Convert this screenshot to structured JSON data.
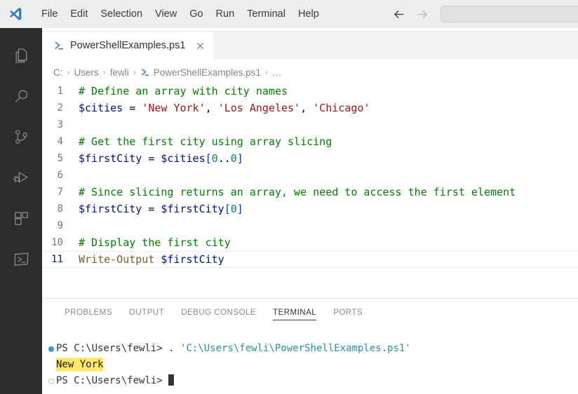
{
  "titlebar": {
    "logo_icon": "vscode-logo-icon",
    "menus": [
      {
        "label": "File"
      },
      {
        "label": "Edit"
      },
      {
        "label": "Selection"
      },
      {
        "label": "View"
      },
      {
        "label": "Go"
      },
      {
        "label": "Run"
      },
      {
        "label": "Terminal"
      },
      {
        "label": "Help"
      }
    ],
    "nav_back_icon": "arrow-left-icon",
    "nav_forward_icon": "arrow-right-icon",
    "command_center": {
      "value": "",
      "placeholder": ""
    }
  },
  "activitybar": {
    "items": [
      {
        "name": "explorer",
        "icon": "files-icon"
      },
      {
        "name": "search",
        "icon": "search-icon"
      },
      {
        "name": "source-control",
        "icon": "source-control-icon"
      },
      {
        "name": "run-and-debug",
        "icon": "run-debug-icon"
      },
      {
        "name": "extensions",
        "icon": "extensions-icon"
      },
      {
        "name": "terminal",
        "icon": "terminal-icon"
      }
    ]
  },
  "editor": {
    "tab": {
      "icon": "powershell-icon",
      "label": "PowerShellExamples.ps1",
      "close_icon": "close-icon",
      "dirty": false
    },
    "breadcrumb": {
      "separator": "›",
      "items": [
        {
          "label": "C:",
          "icon": ""
        },
        {
          "label": "Users",
          "icon": ""
        },
        {
          "label": "fewli",
          "icon": ""
        },
        {
          "label": "PowerShellExamples.ps1",
          "icon": "powershell-icon"
        },
        {
          "label": "…",
          "icon": ""
        }
      ]
    },
    "active_line": 11,
    "lines": [
      {
        "number": "1",
        "tokens": [
          {
            "t": "# Define an array with city names",
            "c": "tok-comment"
          }
        ]
      },
      {
        "number": "2",
        "tokens": [
          {
            "t": "$cities",
            "c": "tok-var"
          },
          {
            "t": " = ",
            "c": "tok-op"
          },
          {
            "t": "'New York'",
            "c": "tok-str"
          },
          {
            "t": ", ",
            "c": "tok-plain"
          },
          {
            "t": "'Los Angeles'",
            "c": "tok-str"
          },
          {
            "t": ", ",
            "c": "tok-plain"
          },
          {
            "t": "'Chicago'",
            "c": "tok-str"
          }
        ]
      },
      {
        "number": "3",
        "tokens": []
      },
      {
        "number": "4",
        "tokens": [
          {
            "t": "# Get the first city using array slicing",
            "c": "tok-comment"
          }
        ]
      },
      {
        "number": "5",
        "tokens": [
          {
            "t": "$firstCity",
            "c": "tok-var"
          },
          {
            "t": " = ",
            "c": "tok-op"
          },
          {
            "t": "$cities",
            "c": "tok-var"
          },
          {
            "t": "[",
            "c": "tok-bracket"
          },
          {
            "t": "0",
            "c": "tok-num"
          },
          {
            "t": "..",
            "c": "tok-plain"
          },
          {
            "t": "0",
            "c": "tok-num"
          },
          {
            "t": "]",
            "c": "tok-bracket"
          }
        ]
      },
      {
        "number": "6",
        "tokens": []
      },
      {
        "number": "7",
        "tokens": [
          {
            "t": "# Since slicing returns an array, we need to access the first element",
            "c": "tok-comment"
          }
        ]
      },
      {
        "number": "8",
        "tokens": [
          {
            "t": "$firstCity",
            "c": "tok-var"
          },
          {
            "t": " = ",
            "c": "tok-op"
          },
          {
            "t": "$firstCity",
            "c": "tok-var"
          },
          {
            "t": "[",
            "c": "tok-bracket"
          },
          {
            "t": "0",
            "c": "tok-num"
          },
          {
            "t": "]",
            "c": "tok-bracket"
          }
        ]
      },
      {
        "number": "9",
        "tokens": []
      },
      {
        "number": "10",
        "tokens": [
          {
            "t": "# Display the first city",
            "c": "tok-comment"
          }
        ]
      },
      {
        "number": "11",
        "tokens": [
          {
            "t": "Write-Output",
            "c": "tok-func"
          },
          {
            "t": " ",
            "c": "tok-plain"
          },
          {
            "t": "$firstCity",
            "c": "tok-var"
          }
        ]
      }
    ]
  },
  "panel": {
    "tabs": [
      {
        "label": "PROBLEMS",
        "active": false
      },
      {
        "label": "OUTPUT",
        "active": false
      },
      {
        "label": "DEBUG CONSOLE",
        "active": false
      },
      {
        "label": "TERMINAL",
        "active": true
      },
      {
        "label": "PORTS",
        "active": false
      }
    ],
    "terminal": {
      "lines": [
        {
          "deco": "dot-filled",
          "segments": [
            {
              "t": "PS C:\\Users\\fewli> . ",
              "c": "t-prompt"
            },
            {
              "t": "'C:\\Users\\fewli\\PowerShellExamples.ps1'",
              "c": "t-path"
            }
          ]
        },
        {
          "deco": "none",
          "segments": [
            {
              "t": "New York",
              "c": "t-out"
            }
          ]
        },
        {
          "deco": "dot-hollow",
          "segments": [
            {
              "t": "PS C:\\Users\\fewli> ",
              "c": "t-prompt"
            },
            {
              "t": "",
              "c": "t-cursor"
            }
          ]
        }
      ]
    }
  },
  "colors": {
    "titlebar_bg": "#ededed",
    "activitybar_bg": "#2c2c2c",
    "tabbar_bg": "#f3f3f3",
    "editor_bg": "#ffffff",
    "accent_blue": "#0078d4",
    "highlight_yellow": "#ffe86b",
    "comment_green": "#008000",
    "string_red": "#a31515",
    "variable_navy": "#001080",
    "function_olive": "#795e26",
    "terminal_path_teal": "#2a8fa8"
  }
}
